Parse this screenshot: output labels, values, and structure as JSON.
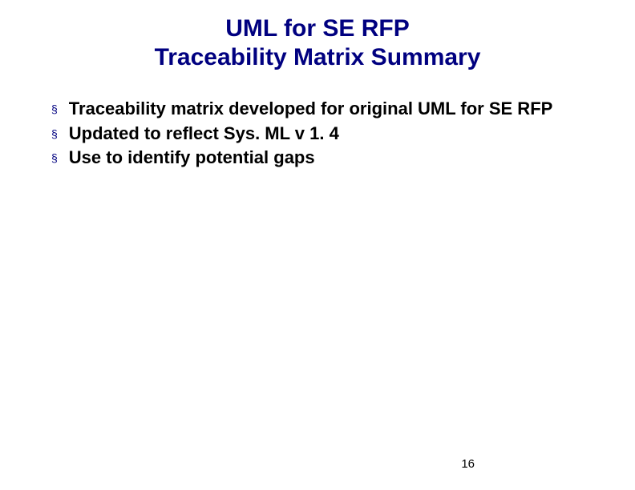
{
  "title_line1": "UML for SE RFP",
  "title_line2": "Traceability Matrix Summary",
  "bullets": {
    "0": "Traceability matrix developed for original UML for SE RFP",
    "1": "Updated to reflect Sys. ML v 1. 4",
    "2": "Use to identify potential gaps"
  },
  "page_number": "16"
}
